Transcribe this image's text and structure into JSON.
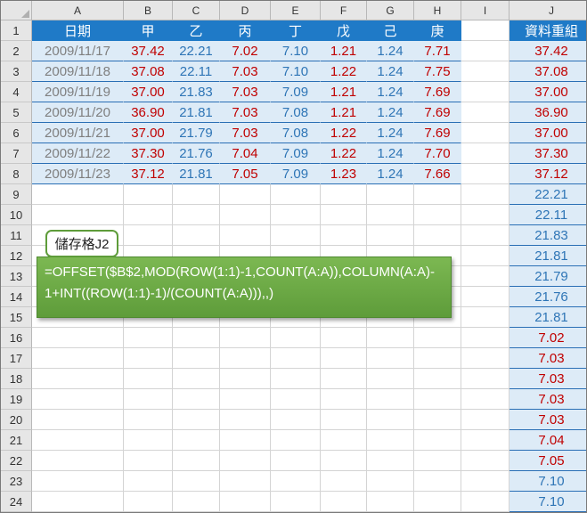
{
  "columns": [
    "A",
    "B",
    "C",
    "D",
    "E",
    "F",
    "G",
    "H",
    "I",
    "J"
  ],
  "rows": [
    "1",
    "2",
    "3",
    "4",
    "5",
    "6",
    "7",
    "8",
    "9",
    "10",
    "11",
    "12",
    "13",
    "14",
    "15",
    "16",
    "17",
    "18",
    "19",
    "20",
    "21",
    "22",
    "23",
    "24"
  ],
  "header_row": [
    "日期",
    "甲",
    "乙",
    "丙",
    "丁",
    "戊",
    "己",
    "庚"
  ],
  "table": [
    [
      "2009/11/17",
      "37.42",
      "22.21",
      "7.02",
      "7.10",
      "1.21",
      "1.24",
      "7.71"
    ],
    [
      "2009/11/18",
      "37.08",
      "22.11",
      "7.03",
      "7.10",
      "1.22",
      "1.24",
      "7.75"
    ],
    [
      "2009/11/19",
      "37.00",
      "21.83",
      "7.03",
      "7.09",
      "1.21",
      "1.24",
      "7.69"
    ],
    [
      "2009/11/20",
      "36.90",
      "21.81",
      "7.03",
      "7.08",
      "1.21",
      "1.24",
      "7.69"
    ],
    [
      "2009/11/21",
      "37.00",
      "21.79",
      "7.03",
      "7.08",
      "1.22",
      "1.24",
      "7.69"
    ],
    [
      "2009/11/22",
      "37.30",
      "21.76",
      "7.04",
      "7.09",
      "1.22",
      "1.24",
      "7.70"
    ],
    [
      "2009/11/23",
      "37.12",
      "21.81",
      "7.05",
      "7.09",
      "1.23",
      "1.24",
      "7.66"
    ]
  ],
  "j_header": "資料重組",
  "j_values": [
    "37.42",
    "37.08",
    "37.00",
    "36.90",
    "37.00",
    "37.30",
    "37.12",
    "22.21",
    "22.11",
    "21.83",
    "21.81",
    "21.79",
    "21.76",
    "21.81",
    "7.02",
    "7.03",
    "7.03",
    "7.03",
    "7.03",
    "7.04",
    "7.05",
    "7.10",
    "7.10"
  ],
  "callout": {
    "title": "儲存格J2",
    "formula_line1": "=OFFSET($B$2,MOD(ROW(1:1)-1,COUNT(A:A)),COLUMN(A:A)-",
    "formula_line2": "1+INT((ROW(1:1)-1)/(COUNT(A:A))),,)"
  },
  "colors": {
    "header_blue": "#1f7ac7",
    "band_blue": "#ddebf7",
    "value_red": "#c00000",
    "value_blue": "#2e75b6",
    "date_gray": "#7f7f7f",
    "callout_green": "#6aa84f"
  }
}
